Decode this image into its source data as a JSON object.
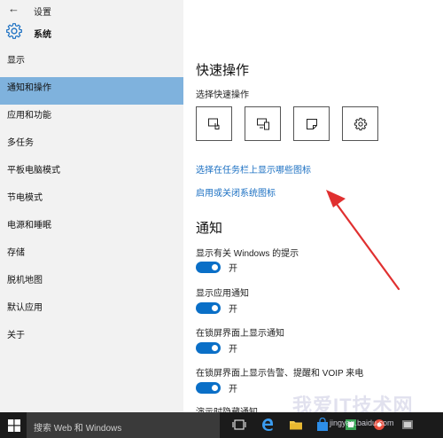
{
  "window": {
    "back_glyph": "←",
    "title": "设置"
  },
  "header": {
    "icon": "gear-icon",
    "title": "系统"
  },
  "nav": {
    "items": [
      {
        "label": "显示",
        "active": false
      },
      {
        "label": "通知和操作",
        "active": true
      },
      {
        "label": "应用和功能",
        "active": false
      },
      {
        "label": "多任务",
        "active": false
      },
      {
        "label": "平板电脑模式",
        "active": false
      },
      {
        "label": "节电模式",
        "active": false
      },
      {
        "label": "电源和睡眠",
        "active": false
      },
      {
        "label": "存储",
        "active": false
      },
      {
        "label": "脱机地图",
        "active": false
      },
      {
        "label": "默认应用",
        "active": false
      },
      {
        "label": "关于",
        "active": false
      }
    ]
  },
  "main": {
    "quick_actions_title": "快速操作",
    "quick_actions_sub": "选择快速操作",
    "quick_action_icons": [
      "touch-icon",
      "display-icon",
      "note-icon",
      "settings-icon"
    ],
    "link_taskbar": "选择在任务栏上显示哪些图标",
    "link_system_icons": "启用或关闭系统图标",
    "notifications_title": "通知",
    "options": [
      {
        "label": "显示有关 Windows 的提示",
        "state": "开"
      },
      {
        "label": "显示应用通知",
        "state": "开"
      },
      {
        "label": "在锁屏界面上显示通知",
        "state": "开"
      },
      {
        "label": "在锁屏界面上显示告警、提醒和 VOIP 来电",
        "state": "开"
      },
      {
        "label": "演示时隐藏通知",
        "state": ""
      }
    ]
  },
  "taskbar": {
    "search_placeholder": "搜索 Web 和 Windows",
    "icons": [
      "windows-start-icon",
      "task-view-icon",
      "edge-icon",
      "file-explorer-icon",
      "store-icon",
      "app-icon",
      "app-icon-2",
      "app-icon-3"
    ]
  },
  "watermark": {
    "text": "我爱IT技术网",
    "sub": "jingyan.baidu.com"
  },
  "colors": {
    "accent": "#0a6fc7",
    "nav_active": "#7fb2dd",
    "link": "#1a6fc2",
    "arrow": "#e03030",
    "taskbar": "#1b1b1b"
  }
}
